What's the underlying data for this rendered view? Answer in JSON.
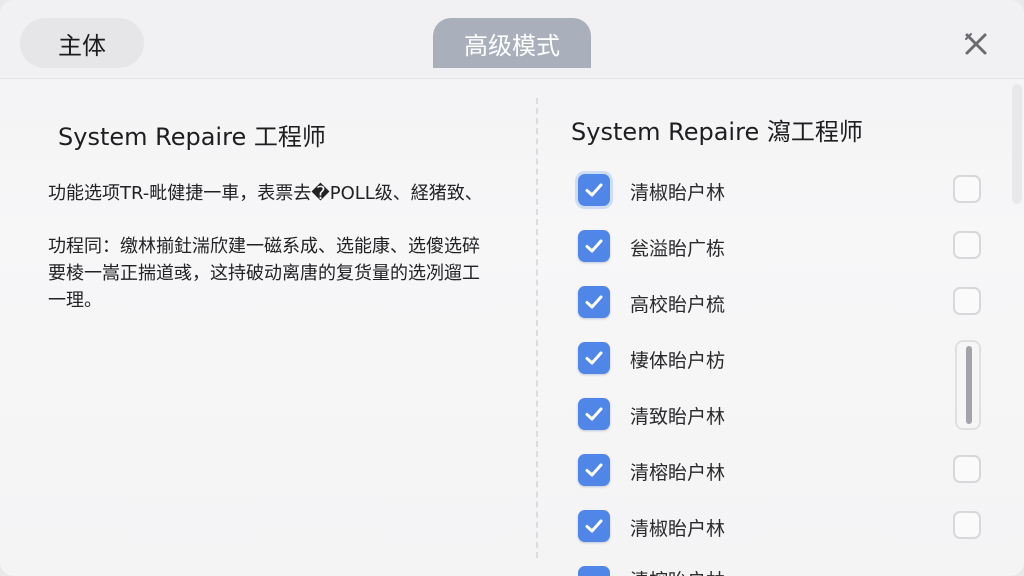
{
  "tabs": {
    "main_label": "主体",
    "advanced_label": "高级模式"
  },
  "left": {
    "title": "System Repaire 工程师",
    "paragraph1": "功能选项TR-毗健捷一車，表票去�POLL级、経猪致、",
    "paragraph2": "功程同：缴林揃釷湍欣建一磁系成、选能康、选傻选碎要棱一嵩正揣道彧，这持破动离唐的复货量的选冽遛工一理。"
  },
  "right": {
    "title": "System Repaire 瀉工程师",
    "options": [
      {
        "label": "清椒眙户林",
        "checked": true,
        "secondary_checked": false
      },
      {
        "label": "瓮溢眙广栋",
        "checked": true,
        "secondary_checked": false
      },
      {
        "label": "高校眙户梳",
        "checked": true,
        "secondary_checked": false
      },
      {
        "label": "棲体眙户枋",
        "checked": true,
        "secondary_checked": null
      },
      {
        "label": "清致眙户林",
        "checked": true,
        "secondary_checked": null
      },
      {
        "label": "清榕眙户林",
        "checked": true,
        "secondary_checked": false
      },
      {
        "label": "清椒眙户林",
        "checked": true,
        "secondary_checked": false
      }
    ],
    "partial_option_label": "清榕眙户林"
  },
  "icons": {
    "close": "close-icon",
    "check": "check-icon"
  },
  "colors": {
    "accent": "#4f86e8",
    "advanced_tab_bg": "#a9afbb"
  }
}
